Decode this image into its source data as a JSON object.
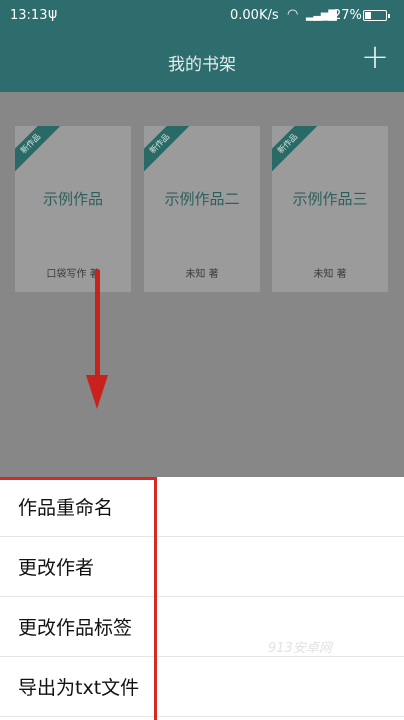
{
  "status_bar": {
    "time": "13:13",
    "network_speed": "0.00K/s",
    "battery_percent": "27%",
    "battery_level": 0.27
  },
  "app_bar": {
    "title": "我的书架",
    "add_label": "+"
  },
  "books": [
    {
      "ribbon": "新作品",
      "title": "示例作品",
      "author": "口袋写作 著"
    },
    {
      "ribbon": "新作品",
      "title": "示例作品二",
      "author": "未知 著"
    },
    {
      "ribbon": "新作品",
      "title": "示例作品三",
      "author": "未知 著"
    }
  ],
  "menu": {
    "items": [
      {
        "label": "作品重命名"
      },
      {
        "label": "更改作者"
      },
      {
        "label": "更改作品标签"
      },
      {
        "label": "导出为txt文件"
      }
    ]
  },
  "watermark": "913安卓网",
  "colors": {
    "primary": "#2d6d6d",
    "annotation": "#c9221c"
  }
}
